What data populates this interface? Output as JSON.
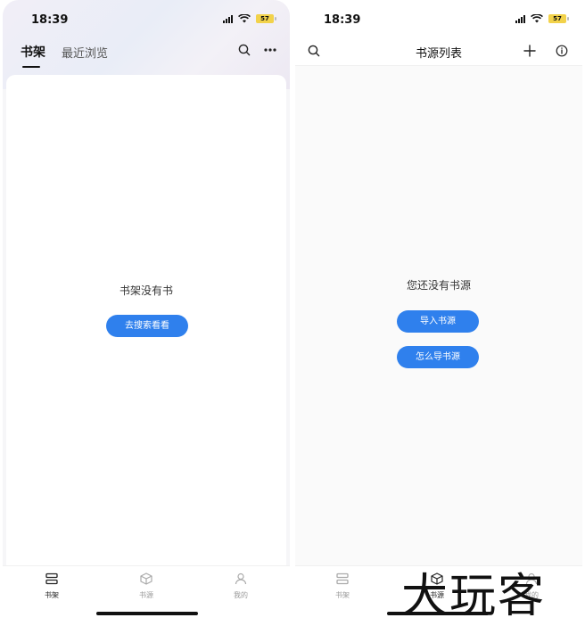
{
  "left_phone": {
    "status": {
      "time": "18:39",
      "battery": "57"
    },
    "tabs": [
      {
        "label": "书架",
        "active": true
      },
      {
        "label": "最近浏览",
        "active": false
      }
    ],
    "header_icons": [
      "search-icon",
      "more-icon"
    ],
    "empty_message": "书架没有书",
    "action_button": "去搜索看看",
    "tabbar": [
      {
        "label": "书架",
        "icon": "bookshelf-icon",
        "active": true
      },
      {
        "label": "书源",
        "icon": "cube-icon",
        "active": false
      },
      {
        "label": "我的",
        "icon": "user-icon",
        "active": false
      }
    ]
  },
  "right_phone": {
    "status": {
      "time": "18:39",
      "battery": "57"
    },
    "title": "书源列表",
    "header_icons": [
      "search-icon",
      "plus-icon",
      "info-icon"
    ],
    "empty_message": "您还没有书源",
    "import_button": "导入书源",
    "howto_button": "怎么导书源",
    "tabbar": [
      {
        "label": "书架",
        "icon": "bookshelf-icon",
        "active": false
      },
      {
        "label": "书源",
        "icon": "cube-icon",
        "active": true
      },
      {
        "label": "我的",
        "icon": "user-icon",
        "active": false
      }
    ]
  },
  "watermark": "大玩客",
  "colors": {
    "accent": "#2f80ed",
    "battery": "#f2d24a"
  }
}
